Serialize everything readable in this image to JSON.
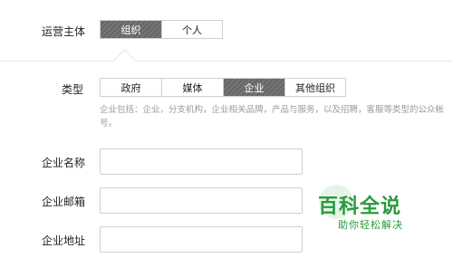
{
  "operator": {
    "label": "运营主体",
    "options": [
      "组织",
      "个人"
    ],
    "selected": "组织"
  },
  "type": {
    "label": "类型",
    "options": [
      "政府",
      "媒体",
      "企业",
      "其他组织"
    ],
    "selected": "企业",
    "description": "企业包括：企业，分支机构，企业相关品牌，产品与服务，以及招聘，客服等类型的公众帐号。"
  },
  "fields": {
    "company_name": {
      "label": "企业名称",
      "value": ""
    },
    "company_email": {
      "label": "企业邮箱",
      "value": ""
    },
    "company_address": {
      "label": "企业地址",
      "value": ""
    }
  },
  "watermark": {
    "title": "百科全说",
    "subtitle": "助你轻松解决",
    "color": "#2a9a3c"
  },
  "colors": {
    "active_segment": "#6e6e6e",
    "border": "#cfcfcf",
    "hint_text": "#9a9a9a"
  }
}
